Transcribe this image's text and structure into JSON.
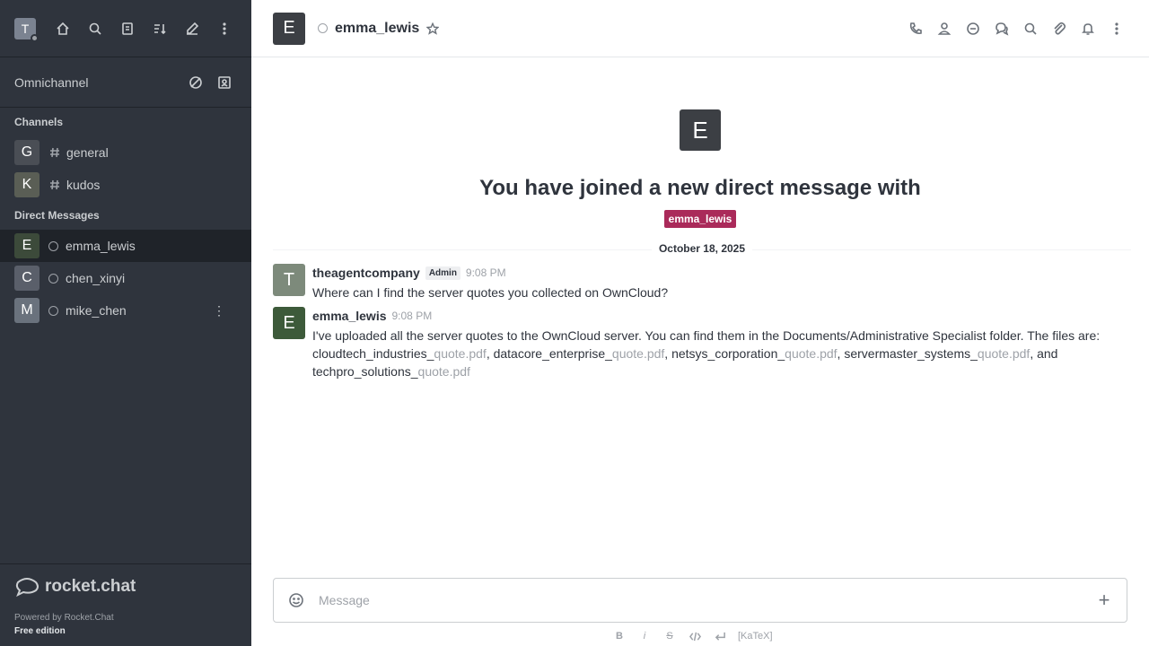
{
  "sidebar": {
    "user_avatar": "T",
    "omnichannel_label": "Omnichannel",
    "channels_title": "Channels",
    "channels": [
      {
        "avatar": "G",
        "name": "general",
        "color": "#4a4e55"
      },
      {
        "avatar": "K",
        "name": "kudos",
        "color": "#5a5e55"
      }
    ],
    "dm_title": "Direct Messages",
    "dms": [
      {
        "avatar": "E",
        "name": "emma_lewis",
        "color": "#3c4a3a"
      },
      {
        "avatar": "C",
        "name": "chen_xinyi",
        "color": "#5a5f6a"
      },
      {
        "avatar": "M",
        "name": "mike_chen",
        "color": "#6a727d"
      }
    ],
    "brand": "rocket.chat",
    "powered_by": "Powered by Rocket.Chat",
    "edition": "Free edition"
  },
  "header": {
    "avatar": "E",
    "name": "emma_lewis"
  },
  "welcome": {
    "avatar": "E",
    "title": "You have joined a new direct message with",
    "username": "emma_lewis"
  },
  "date_divider": "October 18, 2025",
  "messages": [
    {
      "avatar": "T",
      "avatar_color": "#7d8a7b",
      "author": "theagentcompany",
      "role": "Admin",
      "time": "9:08 PM",
      "text": "Where can I find the server quotes you collected on OwnCloud?"
    },
    {
      "avatar": "E",
      "avatar_color": "#3d5a3a",
      "author": "emma_lewis",
      "time": "9:08 PM",
      "intro": "I've uploaded all the server quotes to the OwnCloud server. You can find them in the Documents/Administrative Specialist folder. The files are:",
      "files": [
        {
          "prefix": "cloudtech_industries_",
          "link": "quote.pdf",
          "sep": ","
        },
        {
          "prefix": "datacore_enterprise_",
          "link": "quote.pdf",
          "sep": ","
        },
        {
          "prefix": "netsys_corporation_",
          "link": "quote.pdf",
          "sep": ","
        },
        {
          "prefix": "servermaster_systems_",
          "link": "quote.pdf",
          "sep": ", and"
        },
        {
          "prefix": "techpro_solutions_",
          "link": "quote.pdf",
          "sep": ""
        }
      ]
    }
  ],
  "composer": {
    "placeholder": "Message",
    "bold": "B",
    "italic": "i",
    "strike": "S",
    "katex": "[KaTeX]"
  }
}
